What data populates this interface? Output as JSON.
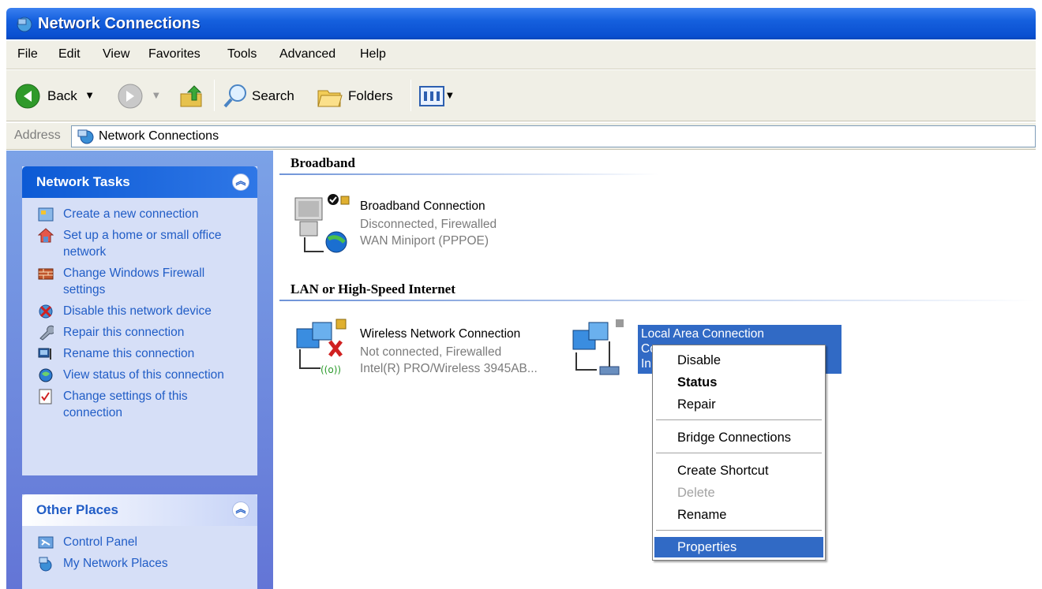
{
  "window": {
    "title": "Network Connections"
  },
  "menubar": [
    "File",
    "Edit",
    "View",
    "Favorites",
    "Tools",
    "Advanced",
    "Help"
  ],
  "toolbar": {
    "back": "Back",
    "search": "Search",
    "folders": "Folders"
  },
  "address": {
    "label": "Address",
    "value": "Network Connections"
  },
  "sidebar": {
    "network_tasks": {
      "title": "Network Tasks",
      "items": [
        "Create a new connection",
        "Set up a home or small office network",
        "Change Windows Firewall settings",
        "Disable this network device",
        "Repair this connection",
        "Rename this connection",
        "View status of this connection",
        "Change settings of this connection"
      ]
    },
    "other_places": {
      "title": "Other Places",
      "items": [
        "Control Panel",
        "My Network Places"
      ]
    }
  },
  "groups": {
    "broadband": "Broadband",
    "lan": "LAN or High-Speed Internet"
  },
  "connections": {
    "broadband": {
      "name": "Broadband Connection",
      "status": "Disconnected, Firewalled",
      "device": "WAN Miniport (PPPOE)"
    },
    "wireless": {
      "name": "Wireless Network Connection",
      "status": "Not connected, Firewalled",
      "device": "Intel(R) PRO/Wireless 3945AB..."
    },
    "local": {
      "name": "Local Area Connection",
      "status": "Co",
      "device": "In"
    }
  },
  "context_menu": {
    "disable": "Disable",
    "status": "Status",
    "repair": "Repair",
    "bridge": "Bridge Connections",
    "create_shortcut": "Create Shortcut",
    "delete": "Delete",
    "rename": "Rename",
    "properties": "Properties"
  },
  "colors": {
    "title_blue": "#0a4fd0",
    "link_blue": "#215dc6",
    "selection": "#316ac5",
    "sidebar": "#6f8ddf"
  }
}
